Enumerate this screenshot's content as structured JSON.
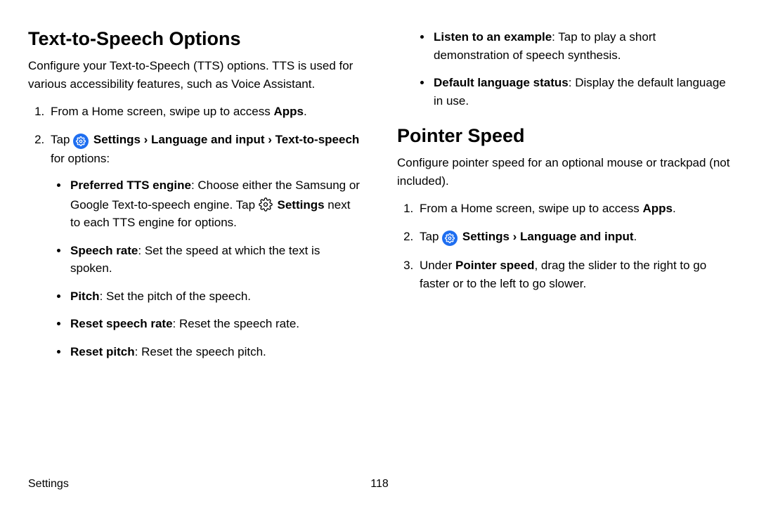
{
  "left": {
    "h1": "Text-to-Speech Options",
    "intro": "Configure your Text-to-Speech (TTS) options. TTS is used for various accessibility features, such as Voice Assistant.",
    "step1_a": "From a Home screen, swipe up to access ",
    "step1_apps": "Apps",
    "step1_b": ".",
    "step2_tap": "Tap ",
    "step2_settings": " Settings",
    "step2_chev1": " › ",
    "step2_lang": "Language and input",
    "step2_chev2": " › ",
    "step2_tts": "Text-to-speech",
    "step2_end": " for options:",
    "b1_term": "Preferred TTS engine",
    "b1_text1": ": Choose either the Samsung or Google Text-to-speech engine. Tap ",
    "b1_settings": " Settings",
    "b1_text2": " next to each TTS engine for options.",
    "b2_term": "Speech rate",
    "b2_text": ": Set the speed at which the text is spoken.",
    "b3_term": "Pitch",
    "b3_text": ": Set the pitch of the speech.",
    "b4_term": "Reset speech rate",
    "b4_text": ": Reset the speech rate.",
    "b5_term": "Reset pitch",
    "b5_text": ": Reset the speech pitch."
  },
  "right_top": {
    "b1_term": "Listen to an example",
    "b1_text": ": Tap to play a short demonstration of speech synthesis.",
    "b2_term": "Default language status",
    "b2_text": ": Display the default language in use."
  },
  "right": {
    "h1": "Pointer Speed",
    "intro": "Configure pointer speed for an optional mouse or trackpad (not included).",
    "step1_a": "From a Home screen, swipe up to access ",
    "step1_apps": "Apps",
    "step1_b": ".",
    "step2_tap": "Tap ",
    "step2_settings": " Settings",
    "step2_chev1": " › ",
    "step2_lang": "Language and input",
    "step2_end": ".",
    "step3_a": "Under ",
    "step3_term": "Pointer speed",
    "step3_b": ", drag the slider to the right to go faster or to the left to go slower."
  },
  "footer": {
    "section": "Settings",
    "page": "118"
  }
}
